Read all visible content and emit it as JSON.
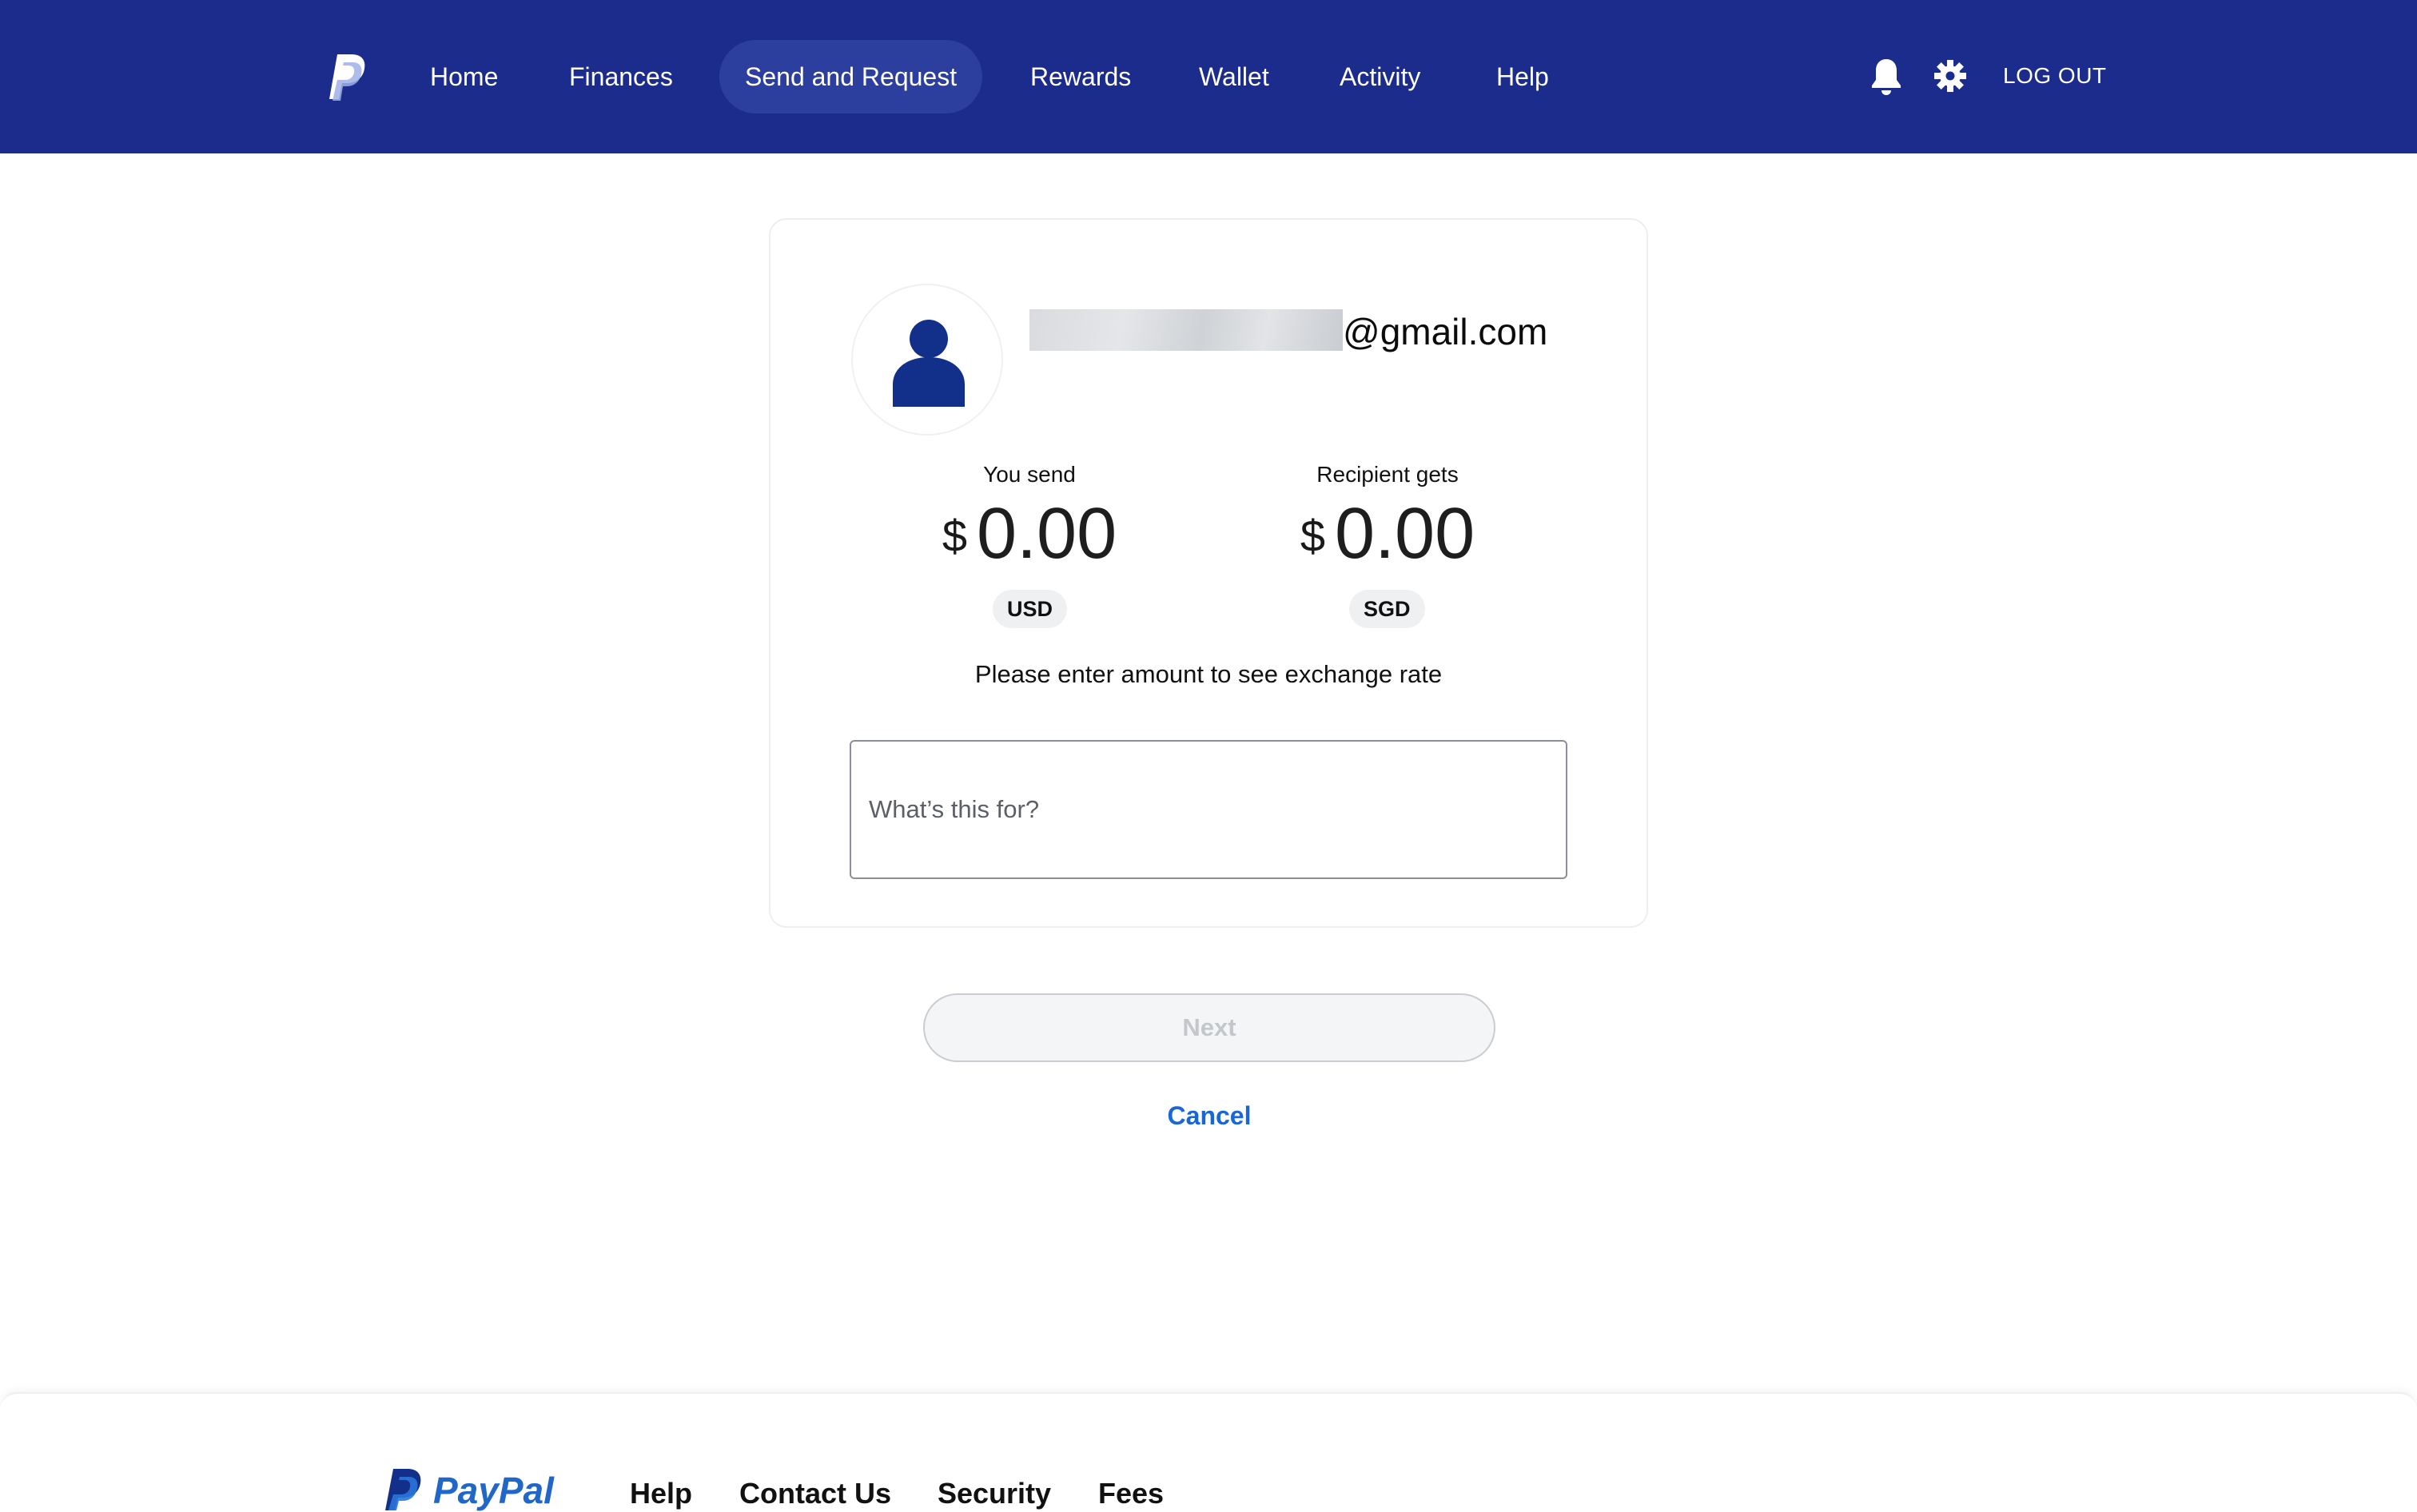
{
  "header": {
    "nav": [
      {
        "label": "Home"
      },
      {
        "label": "Finances"
      },
      {
        "label": "Send and Request",
        "active": true
      },
      {
        "label": "Rewards"
      },
      {
        "label": "Wallet"
      },
      {
        "label": "Activity"
      },
      {
        "label": "Help"
      }
    ],
    "icons": {
      "notifications": "bell-icon",
      "settings": "gear-icon"
    },
    "logout_label": "LOG OUT"
  },
  "recipient": {
    "email_suffix": "@gmail.com",
    "avatar": "person-icon"
  },
  "send": {
    "label": "You send",
    "symbol": "$",
    "amount": "0.00",
    "currency": "USD"
  },
  "receive": {
    "label": "Recipient gets",
    "symbol": "$",
    "amount": "0.00",
    "currency": "SGD"
  },
  "rate_note": "Please enter amount to see exchange rate",
  "note_field": {
    "placeholder": "What’s this for?",
    "value": ""
  },
  "actions": {
    "next_label": "Next",
    "cancel_label": "Cancel"
  },
  "footer": {
    "brand": "PayPal",
    "links": [
      {
        "label": "Help"
      },
      {
        "label": "Contact Us"
      },
      {
        "label": "Security"
      },
      {
        "label": "Fees"
      }
    ]
  },
  "colors": {
    "header_bg": "#1b2c8c",
    "nav_active_bg": "#2d3f9e",
    "accent_link": "#1a66d6",
    "avatar_fill": "#12308a"
  }
}
